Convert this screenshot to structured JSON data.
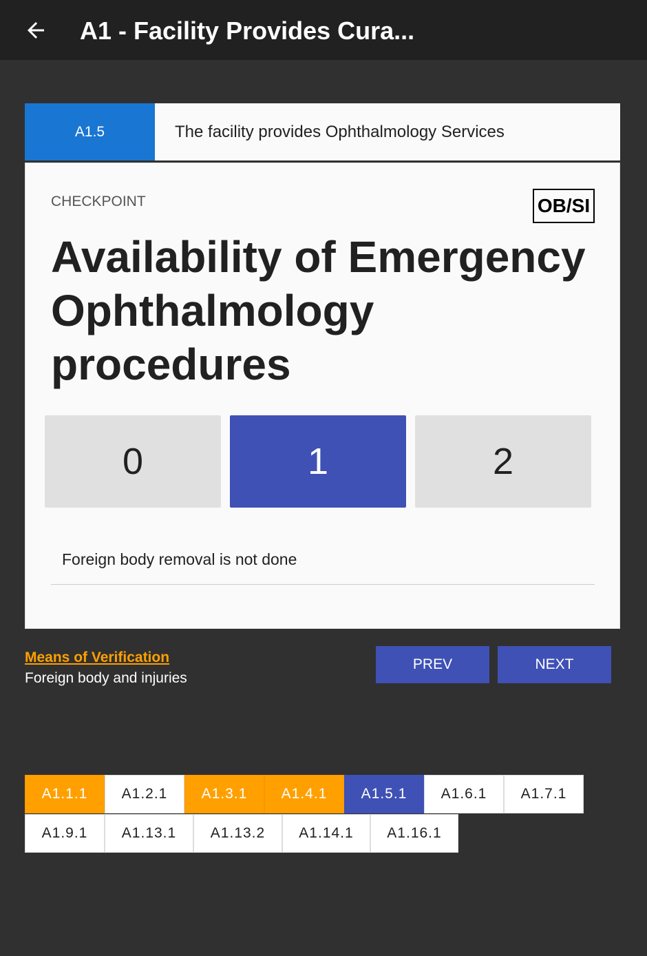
{
  "header": {
    "title": "A1 - Facility Provides Cura...",
    "back_icon": "arrow-left-icon"
  },
  "standard": {
    "code": "A1.5",
    "text": "The facility provides Ophthalmology Services"
  },
  "checkpoint": {
    "label": "CHECKPOINT",
    "badge": "OB/SI",
    "title": "Availability of Emergency Ophthalmology procedures",
    "scores": [
      {
        "label": "0",
        "selected": false
      },
      {
        "label": "1",
        "selected": true
      },
      {
        "label": "2",
        "selected": false
      }
    ],
    "selected_description": "Foreign body removal is not done"
  },
  "verification": {
    "link": "Means of Verification",
    "text": "Foreign body and injuries"
  },
  "nav": {
    "prev": "PREV",
    "next": "NEXT"
  },
  "colors": {
    "done": "#ffa000",
    "current": "#3f51b5",
    "tab": "#1976d2"
  },
  "chips": [
    {
      "label": "A1.1.1",
      "state": "done"
    },
    {
      "label": "A1.2.1",
      "state": "none"
    },
    {
      "label": "A1.3.1",
      "state": "done"
    },
    {
      "label": "A1.4.1",
      "state": "done"
    },
    {
      "label": "A1.5.1",
      "state": "current"
    },
    {
      "label": "A1.6.1",
      "state": "none"
    },
    {
      "label": "A1.7.1",
      "state": "none"
    },
    {
      "label": "A1.9.1",
      "state": "none"
    },
    {
      "label": "A1.13.1",
      "state": "none"
    },
    {
      "label": "A1.13.2",
      "state": "none"
    },
    {
      "label": "A1.14.1",
      "state": "none"
    },
    {
      "label": "A1.16.1",
      "state": "none"
    }
  ]
}
